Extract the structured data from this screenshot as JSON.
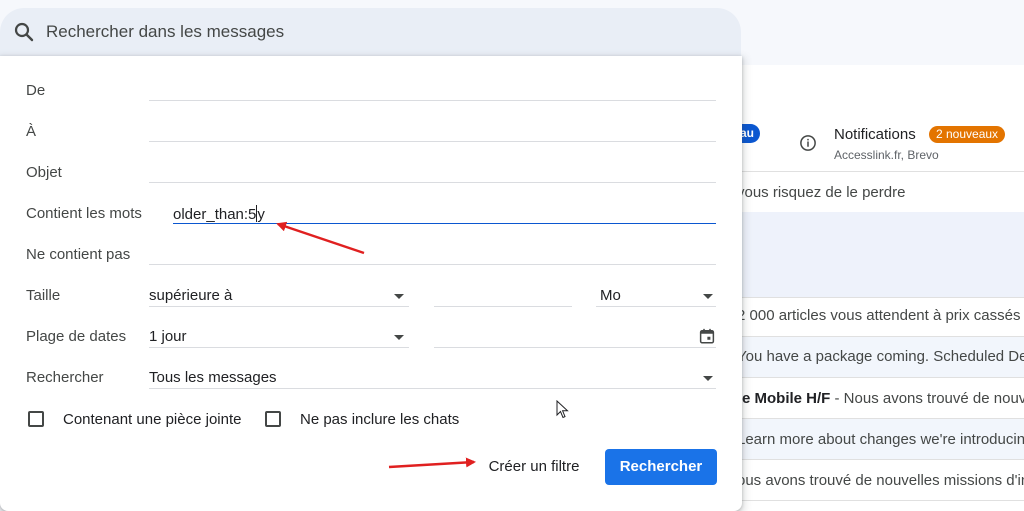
{
  "search": {
    "placeholder": "Rechercher dans les messages",
    "icon": "search-icon"
  },
  "background": {
    "badge_new": "au",
    "notifications": {
      "title": "Notifications",
      "badge": "2 nouveaux",
      "senders": "Accesslink.fr, Brevo",
      "icon": "info-icon"
    },
    "rows": [
      "vous risquez de le perdre",
      "2 000 articles vous attendent à prix cassés",
      "You have a package coming. Scheduled Deli",
      "Learn more about changes we're introducin",
      "ous avons trouvé de nouvelles missions d'in"
    ],
    "row_bold": {
      "bold": "te Mobile H/F",
      "rest": " - Nous avons trouvé de nouv"
    }
  },
  "form": {
    "from_label": "De",
    "to_label": "À",
    "subject_label": "Objet",
    "has_words_label": "Contient les mots",
    "has_words_value": "older_than:5",
    "has_words_value_tail": "y",
    "doesnt_have_label": "Ne contient pas",
    "size_label": "Taille",
    "size_operator": "supérieure à",
    "size_unit": "Mo",
    "date_label": "Plage de dates",
    "date_range": "1 jour",
    "search_in_label": "Rechercher",
    "search_in_value": "Tous les messages",
    "has_attachment_label": "Contenant une pièce jointe",
    "exclude_chats_label": "Ne pas inclure les chats",
    "create_filter_label": "Créer un filtre",
    "search_button_label": "Rechercher"
  },
  "colors": {
    "accent_blue": "#1a73e8",
    "badge_orange": "#e37400",
    "annotation_red": "#e02020"
  }
}
